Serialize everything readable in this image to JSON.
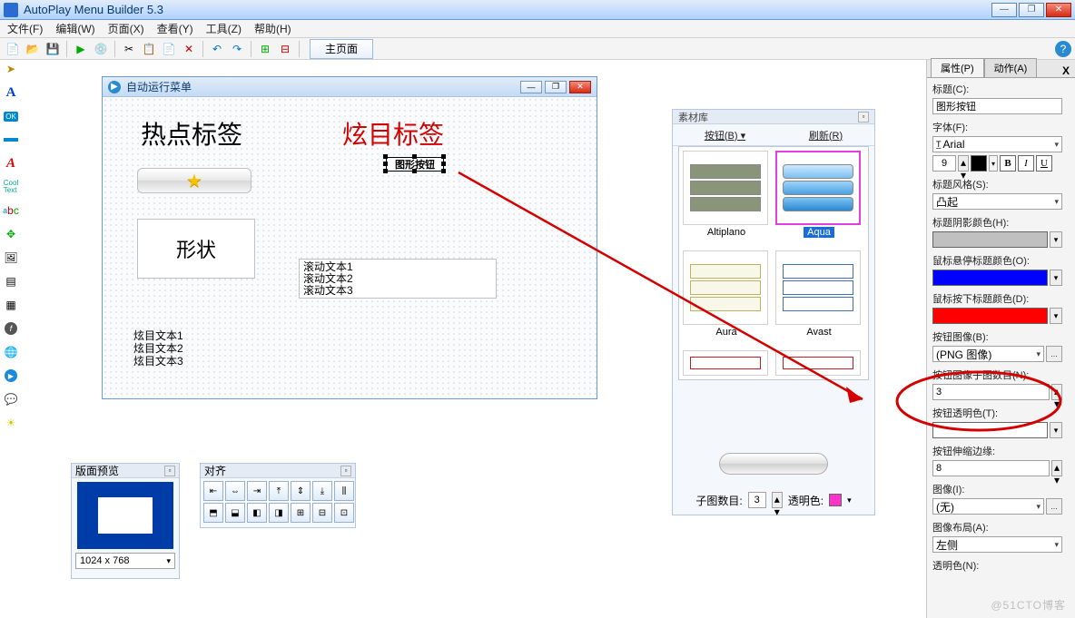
{
  "app": {
    "title": "AutoPlay Menu Builder 5.3"
  },
  "menubar": [
    "文件(F)",
    "编辑(W)",
    "页面(X)",
    "查看(Y)",
    "工具(Z)",
    "帮助(H)"
  ],
  "tab": {
    "main": "主页面"
  },
  "canvas": {
    "title": "自动运行菜单",
    "label_hot": "热点标签",
    "label_flash": "炫目标签",
    "selected_button_text": "图形按钮",
    "shape_text": "形状",
    "scroll_lines": [
      "滚动文本1",
      "滚动文本2",
      "滚动文本3"
    ],
    "flash_lines": [
      "炫目文本1",
      "炫目文本2",
      "炫目文本3"
    ]
  },
  "matlib": {
    "title": "素材库",
    "btn_menu": "按钮(B)",
    "refresh": "刷新(R)",
    "items": [
      {
        "name": "Altiplano",
        "selected": false
      },
      {
        "name": "Aqua",
        "selected": true
      },
      {
        "name": "Aura",
        "selected": false
      },
      {
        "name": "Avast",
        "selected": false
      }
    ],
    "footer_label": "子图数目:",
    "footer_count": "3",
    "footer_trans": "透明色:",
    "footer_swatch": "#ff33cc"
  },
  "props": {
    "tab_props": "属性(P)",
    "tab_actions": "动作(A)",
    "title_label": "标题(C):",
    "title_value": "图形按钮",
    "font_label": "字体(F):",
    "font_value": "Arial",
    "font_size": "9",
    "style_label": "标题风格(S):",
    "style_value": "凸起",
    "shadow_label": "标题阴影颜色(H):",
    "shadow_color": "#c0c0c0",
    "hover_label": "鼠标悬停标题颜色(O):",
    "hover_color": "#0000ff",
    "down_label": "鼠标按下标题颜色(D):",
    "down_color": "#ff0000",
    "btnimg_label": "按钮图像(B):",
    "btnimg_value": "(PNG 图像)",
    "subcount_label": "按钮图像子图数目(N):",
    "subcount_value": "3",
    "trans_label": "按钮透明色(T):",
    "trans_color": "#ffffff",
    "stretch_label": "按钮伸缩边缘:",
    "stretch_value": "8",
    "image_label": "图像(I):",
    "image_value": "(无)",
    "layout_label": "图像布局(A):",
    "layout_value": "左侧",
    "transN_label": "透明色(N):"
  },
  "preview": {
    "title": "版面预览",
    "size": "1024 x 768"
  },
  "align": {
    "title": "对齐"
  },
  "watermark": "@51CTO博客"
}
